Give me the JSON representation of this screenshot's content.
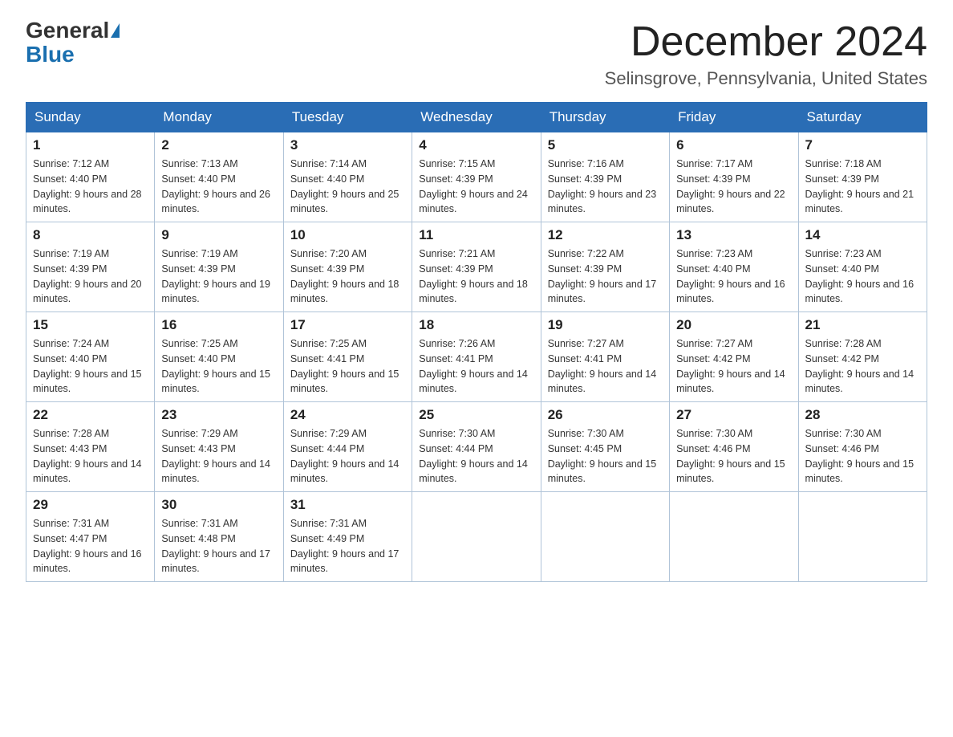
{
  "logo": {
    "general": "General",
    "blue": "Blue"
  },
  "title": "December 2024",
  "subtitle": "Selinsgrove, Pennsylvania, United States",
  "weekdays": [
    "Sunday",
    "Monday",
    "Tuesday",
    "Wednesday",
    "Thursday",
    "Friday",
    "Saturday"
  ],
  "weeks": [
    [
      {
        "day": "1",
        "sunrise": "7:12 AM",
        "sunset": "4:40 PM",
        "daylight": "9 hours and 28 minutes."
      },
      {
        "day": "2",
        "sunrise": "7:13 AM",
        "sunset": "4:40 PM",
        "daylight": "9 hours and 26 minutes."
      },
      {
        "day": "3",
        "sunrise": "7:14 AM",
        "sunset": "4:40 PM",
        "daylight": "9 hours and 25 minutes."
      },
      {
        "day": "4",
        "sunrise": "7:15 AM",
        "sunset": "4:39 PM",
        "daylight": "9 hours and 24 minutes."
      },
      {
        "day": "5",
        "sunrise": "7:16 AM",
        "sunset": "4:39 PM",
        "daylight": "9 hours and 23 minutes."
      },
      {
        "day": "6",
        "sunrise": "7:17 AM",
        "sunset": "4:39 PM",
        "daylight": "9 hours and 22 minutes."
      },
      {
        "day": "7",
        "sunrise": "7:18 AM",
        "sunset": "4:39 PM",
        "daylight": "9 hours and 21 minutes."
      }
    ],
    [
      {
        "day": "8",
        "sunrise": "7:19 AM",
        "sunset": "4:39 PM",
        "daylight": "9 hours and 20 minutes."
      },
      {
        "day": "9",
        "sunrise": "7:19 AM",
        "sunset": "4:39 PM",
        "daylight": "9 hours and 19 minutes."
      },
      {
        "day": "10",
        "sunrise": "7:20 AM",
        "sunset": "4:39 PM",
        "daylight": "9 hours and 18 minutes."
      },
      {
        "day": "11",
        "sunrise": "7:21 AM",
        "sunset": "4:39 PM",
        "daylight": "9 hours and 18 minutes."
      },
      {
        "day": "12",
        "sunrise": "7:22 AM",
        "sunset": "4:39 PM",
        "daylight": "9 hours and 17 minutes."
      },
      {
        "day": "13",
        "sunrise": "7:23 AM",
        "sunset": "4:40 PM",
        "daylight": "9 hours and 16 minutes."
      },
      {
        "day": "14",
        "sunrise": "7:23 AM",
        "sunset": "4:40 PM",
        "daylight": "9 hours and 16 minutes."
      }
    ],
    [
      {
        "day": "15",
        "sunrise": "7:24 AM",
        "sunset": "4:40 PM",
        "daylight": "9 hours and 15 minutes."
      },
      {
        "day": "16",
        "sunrise": "7:25 AM",
        "sunset": "4:40 PM",
        "daylight": "9 hours and 15 minutes."
      },
      {
        "day": "17",
        "sunrise": "7:25 AM",
        "sunset": "4:41 PM",
        "daylight": "9 hours and 15 minutes."
      },
      {
        "day": "18",
        "sunrise": "7:26 AM",
        "sunset": "4:41 PM",
        "daylight": "9 hours and 14 minutes."
      },
      {
        "day": "19",
        "sunrise": "7:27 AM",
        "sunset": "4:41 PM",
        "daylight": "9 hours and 14 minutes."
      },
      {
        "day": "20",
        "sunrise": "7:27 AM",
        "sunset": "4:42 PM",
        "daylight": "9 hours and 14 minutes."
      },
      {
        "day": "21",
        "sunrise": "7:28 AM",
        "sunset": "4:42 PM",
        "daylight": "9 hours and 14 minutes."
      }
    ],
    [
      {
        "day": "22",
        "sunrise": "7:28 AM",
        "sunset": "4:43 PM",
        "daylight": "9 hours and 14 minutes."
      },
      {
        "day": "23",
        "sunrise": "7:29 AM",
        "sunset": "4:43 PM",
        "daylight": "9 hours and 14 minutes."
      },
      {
        "day": "24",
        "sunrise": "7:29 AM",
        "sunset": "4:44 PM",
        "daylight": "9 hours and 14 minutes."
      },
      {
        "day": "25",
        "sunrise": "7:30 AM",
        "sunset": "4:44 PM",
        "daylight": "9 hours and 14 minutes."
      },
      {
        "day": "26",
        "sunrise": "7:30 AM",
        "sunset": "4:45 PM",
        "daylight": "9 hours and 15 minutes."
      },
      {
        "day": "27",
        "sunrise": "7:30 AM",
        "sunset": "4:46 PM",
        "daylight": "9 hours and 15 minutes."
      },
      {
        "day": "28",
        "sunrise": "7:30 AM",
        "sunset": "4:46 PM",
        "daylight": "9 hours and 15 minutes."
      }
    ],
    [
      {
        "day": "29",
        "sunrise": "7:31 AM",
        "sunset": "4:47 PM",
        "daylight": "9 hours and 16 minutes."
      },
      {
        "day": "30",
        "sunrise": "7:31 AM",
        "sunset": "4:48 PM",
        "daylight": "9 hours and 17 minutes."
      },
      {
        "day": "31",
        "sunrise": "7:31 AM",
        "sunset": "4:49 PM",
        "daylight": "9 hours and 17 minutes."
      },
      null,
      null,
      null,
      null
    ]
  ]
}
